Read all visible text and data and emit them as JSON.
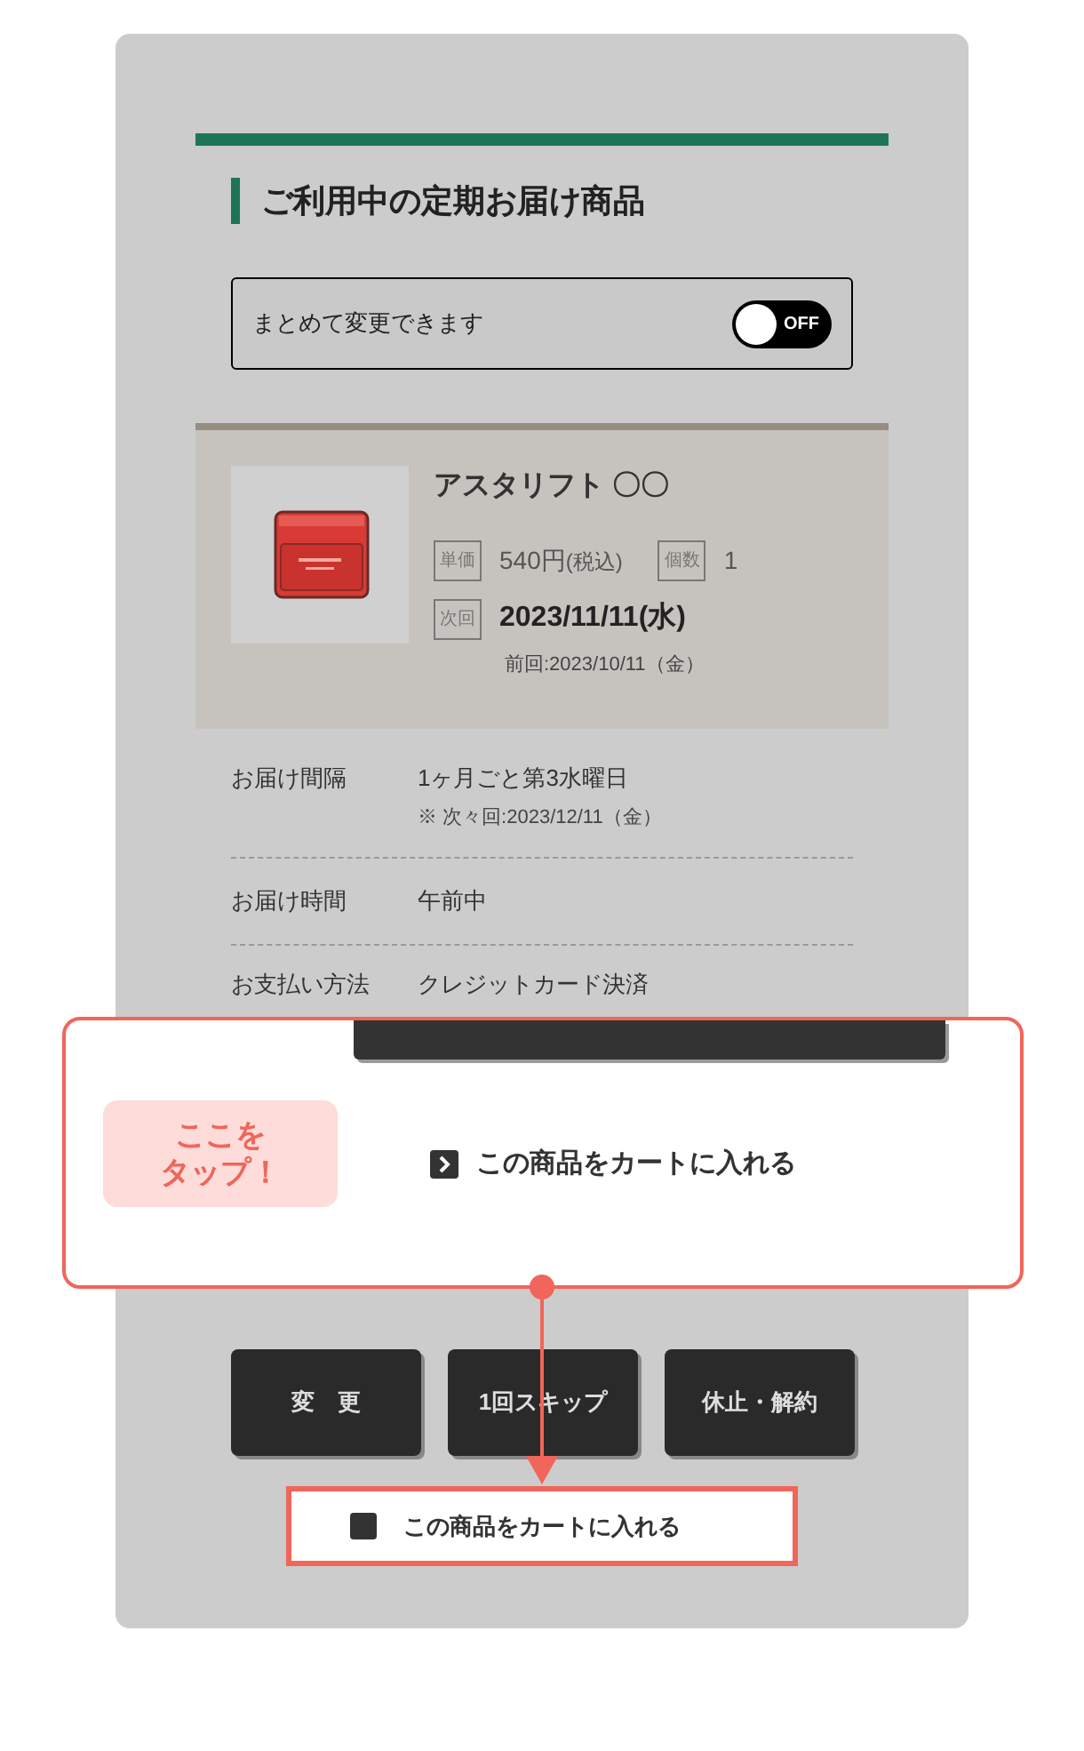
{
  "heading": "ご利用中の定期お届け商品",
  "bulk_change": {
    "label": "まとめて変更できます",
    "toggle": {
      "on": false,
      "label": "OFF"
    }
  },
  "product": {
    "name": "アスタリフト 〇〇",
    "price_tag": "単価",
    "price": "540円",
    "price_note": "(税込)",
    "qty_tag": "個数",
    "qty": "1",
    "next_tag": "次回",
    "next_date": "2023/11/11(水)",
    "previous": "前回:2023/10/11（金）"
  },
  "details": [
    {
      "label": "お届け間隔",
      "value": "1ヶ月ごと第3水曜日",
      "note": "※ 次々回:2023/12/11（金）"
    },
    {
      "label": "お届け時間",
      "value": "午前中"
    },
    {
      "label": "お支払い方法",
      "value": "クレジットカード決済"
    }
  ],
  "buttons": [
    "変　更",
    "1回スキップ",
    "休止・解約"
  ],
  "cart_checkbox": {
    "label": "この商品をカートに入れる",
    "checked": false
  },
  "callout": {
    "badge": [
      "ここを",
      "タップ！"
    ],
    "button_label": "この商品をカートに入れる"
  }
}
